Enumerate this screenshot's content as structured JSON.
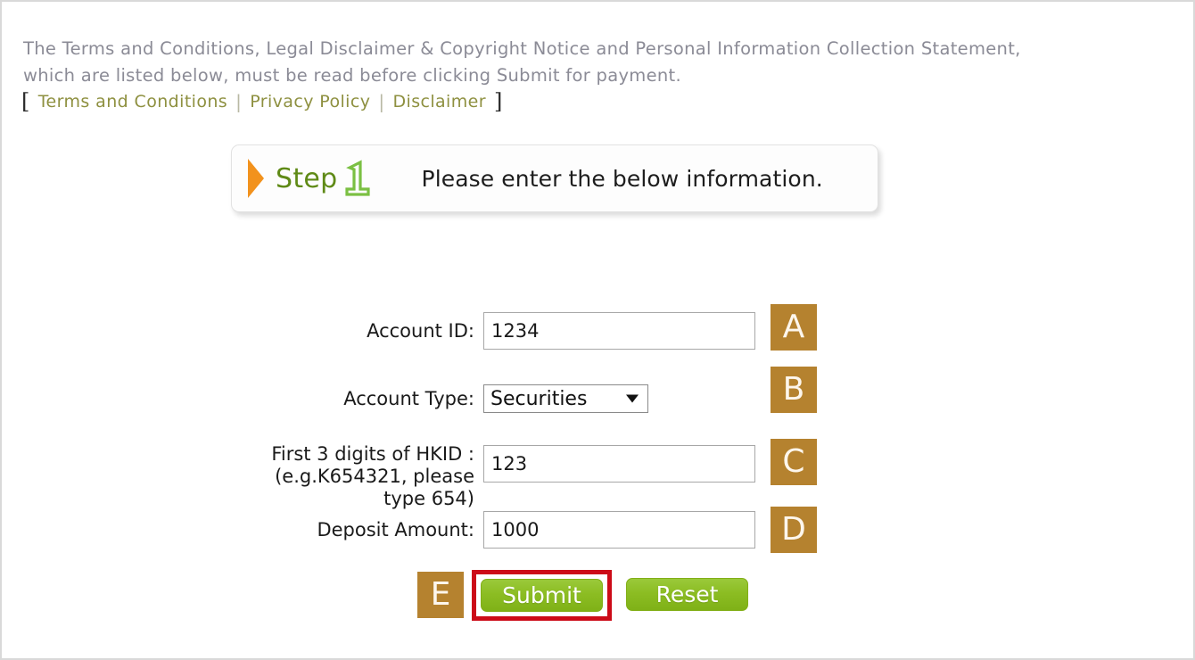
{
  "notice": {
    "paragraph": "The Terms and Conditions, Legal Disclaimer & Copyright Notice and Personal Information Collection Statement,\nwhich are listed below, must be read before clicking Submit for payment."
  },
  "links": {
    "bracket_left": "[",
    "bracket_right": "]",
    "separator": "|",
    "items": [
      {
        "label": "Terms and Conditions"
      },
      {
        "label": "Privacy Policy"
      },
      {
        "label": "Disclaimer"
      }
    ]
  },
  "step": {
    "word": "Step",
    "number": "1",
    "instruction": "Please enter the below information."
  },
  "form": {
    "fields": [
      {
        "label": "Account ID:",
        "value": "1234",
        "placeholder": "",
        "badge": "A",
        "type": "text"
      },
      {
        "label": "Account Type:",
        "value": "Securities",
        "badge": "B",
        "type": "select",
        "options": [
          "Securities"
        ]
      },
      {
        "label": "First 3 digits of HKID :\n(e.g.K654321, please type 654)",
        "value": "123",
        "placeholder": "",
        "badge": "C",
        "type": "text"
      },
      {
        "label": "Deposit Amount:",
        "value": "1000",
        "placeholder": "",
        "badge": "D",
        "type": "text"
      }
    ]
  },
  "actions": {
    "badge": "E",
    "submit_label": "Submit",
    "reset_label": "Reset"
  },
  "colors": {
    "badge_brown": "#b5822f",
    "button_green": "#8cbd23",
    "highlight_red": "#cc0b18",
    "link_olive": "#8e9040",
    "notice_gray": "#8b8b96",
    "step_word_green": "#5f8a16",
    "step_arrow_orange": "#f2921d",
    "step_num_green": "#7bc043"
  }
}
